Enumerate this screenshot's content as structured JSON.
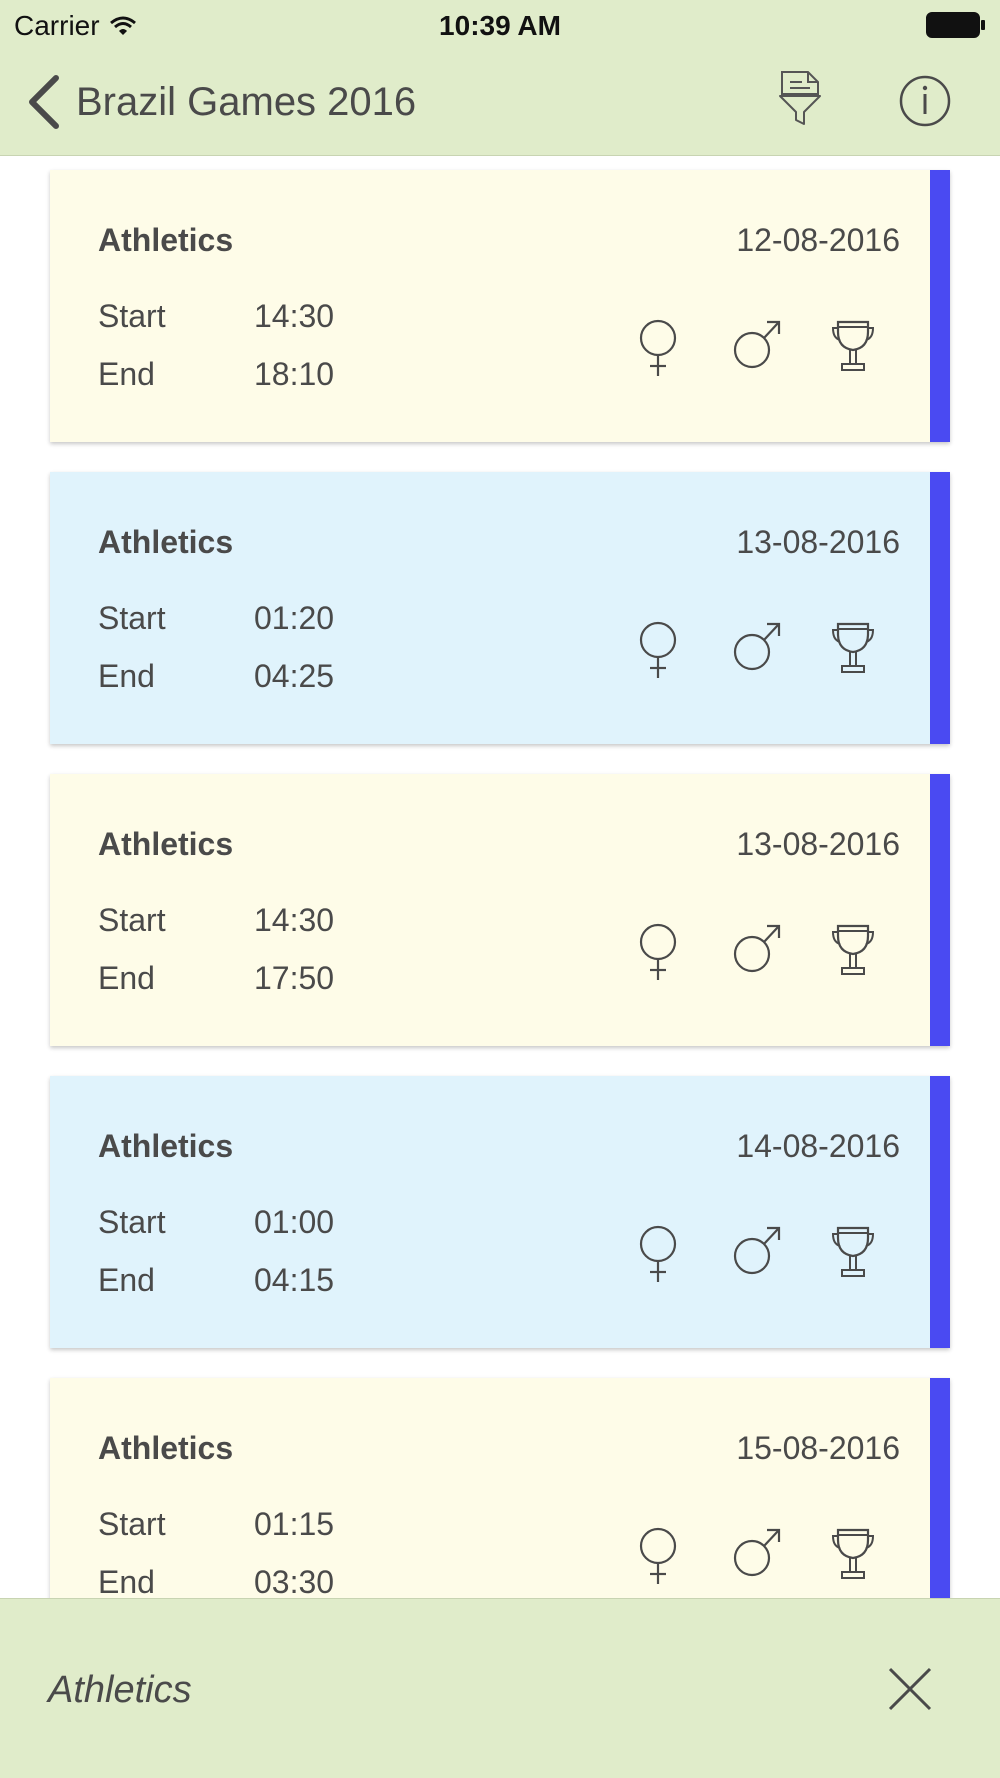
{
  "status_bar": {
    "carrier": "Carrier",
    "time": "10:39 AM"
  },
  "nav": {
    "title": "Brazil Games 2016"
  },
  "labels": {
    "start": "Start",
    "end": "End"
  },
  "cards": [
    {
      "sport": "Athletics",
      "date": "12-08-2016",
      "start": "14:30",
      "end": "18:10",
      "color": "yellow"
    },
    {
      "sport": "Athletics",
      "date": "13-08-2016",
      "start": "01:20",
      "end": "04:25",
      "color": "blue"
    },
    {
      "sport": "Athletics",
      "date": "13-08-2016",
      "start": "14:30",
      "end": "17:50",
      "color": "yellow"
    },
    {
      "sport": "Athletics",
      "date": "14-08-2016",
      "start": "01:00",
      "end": "04:15",
      "color": "blue"
    },
    {
      "sport": "Athletics",
      "date": "15-08-2016",
      "start": "01:15",
      "end": "03:30",
      "color": "yellow"
    }
  ],
  "bottom_bar": {
    "filter_label": "Athletics"
  },
  "colors": {
    "bar_background": "#e0ecca",
    "card_yellow": "#fefce8",
    "card_blue": "#e0f3fc",
    "accent_stripe": "#4a4af2",
    "text": "#4a4a4a"
  },
  "icons": [
    "wifi-icon",
    "battery-icon",
    "back-chevron-icon",
    "filter-document-icon",
    "info-icon",
    "female-icon",
    "male-icon",
    "trophy-icon",
    "close-icon"
  ]
}
